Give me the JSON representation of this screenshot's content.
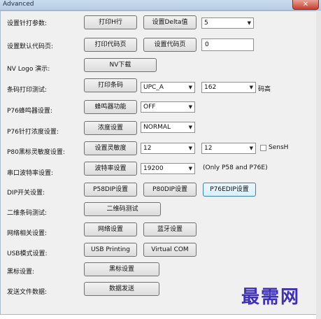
{
  "window": {
    "title": "Advanced",
    "close_glyph": "✕"
  },
  "rows": {
    "print_params": {
      "label": "设置针打参数:",
      "btn1": "打印H行",
      "btn2": "设置Delta值",
      "combo": "5"
    },
    "default_codepage": {
      "label": "设置默认代码页:",
      "btn1": "打印代码页",
      "btn2": "设置代码页",
      "input": "0"
    },
    "nv_logo": {
      "label": "NV Logo 演示:",
      "btn1": "NV下载"
    },
    "barcode_print": {
      "label": "条码打印测试:",
      "btn1": "打印条码",
      "combo1": "UPC_A",
      "combo2": "162",
      "suffix": "码高"
    },
    "buzzer": {
      "label": "P76蜂鸣器设置:",
      "btn1": "蜂鸣器功能",
      "combo": "OFF"
    },
    "density": {
      "label": "P76针打浓度设置:",
      "btn1": "浓度设置",
      "combo": "NORMAL"
    },
    "sensitivity": {
      "label": "P80黑标灵敏度设置:",
      "btn1": "设置灵敏度",
      "combo1": "12",
      "combo2": "12",
      "check_label": "SensH"
    },
    "baud": {
      "label": "串口波特率设置:",
      "btn1": "波特率设置",
      "combo": "19200",
      "note": "(Only P58 and P76E)"
    },
    "dip": {
      "label": "DIP开关设置:",
      "btn1": "P58DIP设置",
      "btn2": "P80DIP设置",
      "btn3": "P76EDIP设置"
    },
    "qr": {
      "label": "二维条码测试:",
      "btn1": "二维码测试"
    },
    "network": {
      "label": "网络相关设置:",
      "btn1": "网络设置",
      "btn2": "蓝牙设置"
    },
    "usb": {
      "label": "USB模式设置:",
      "btn1": "USB Printing",
      "btn2": "Virtual COM"
    },
    "blackmark": {
      "label": "黑标设置:",
      "btn1": "黑标设置"
    },
    "send_file": {
      "label": "发送文件数据:",
      "btn1": "数据发送"
    }
  },
  "watermark": "最需网"
}
